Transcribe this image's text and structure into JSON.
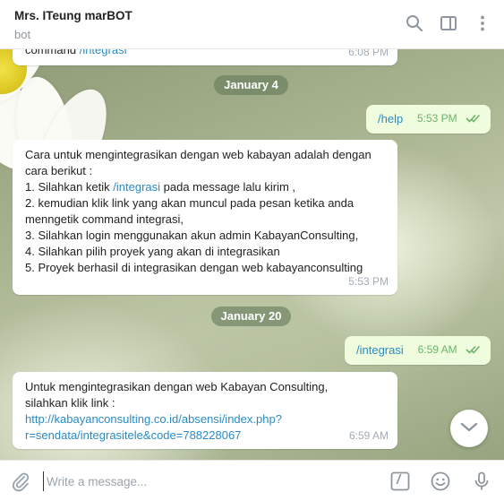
{
  "header": {
    "title": "Mrs. ITeung marBOT",
    "status": "bot",
    "icons": [
      "search-icon",
      "sidebar-toggle-icon",
      "more-vertical-icon"
    ]
  },
  "messages": {
    "m0": {
      "text": "command ",
      "link": "/integrasi",
      "time": "6:08 PM"
    },
    "date1": "January 4",
    "m1": {
      "text": "/help",
      "time": "5:53 PM"
    },
    "m2": {
      "line1": "Cara untuk mengintegrasikan dengan web kabayan adalah dengan",
      "line2": "cara berikut :",
      "line3a": "1. Silahkan ketik ",
      "line3link": "/integrasi",
      "line3b": " pada message lalu kirim ,",
      "line4": "2. kemudian klik link yang akan muncul pada pesan ketika anda",
      "line5": "menngetik command integrasi,",
      "line6": "3. Silahkan login menggunakan akun admin KabayanConsulting,",
      "line7": "4. Silahkan pilih proyek yang akan di integrasikan",
      "line8": "5. Proyek berhasil di integrasikan dengan web kabayanconsulting",
      "time": "5:53 PM"
    },
    "date2": "January 20",
    "m3": {
      "text": "/integrasi",
      "time": "6:59 AM"
    },
    "m4": {
      "line1": "Untuk mengintegrasikan dengan web Kabayan Consulting,",
      "line2": "silahkan klik link :",
      "link1": "http://kabayanconsulting.co.id/absensi/index.php?",
      "link2": "r=sendata/integrasitele&code=788228067",
      "time": "6:59 AM"
    }
  },
  "compose": {
    "placeholder": "Write a message...",
    "command_label": "/"
  },
  "colors": {
    "link": "#2a8bc4",
    "outgoing_bubble": "#effdde",
    "read_checks": "#6cb36a"
  }
}
